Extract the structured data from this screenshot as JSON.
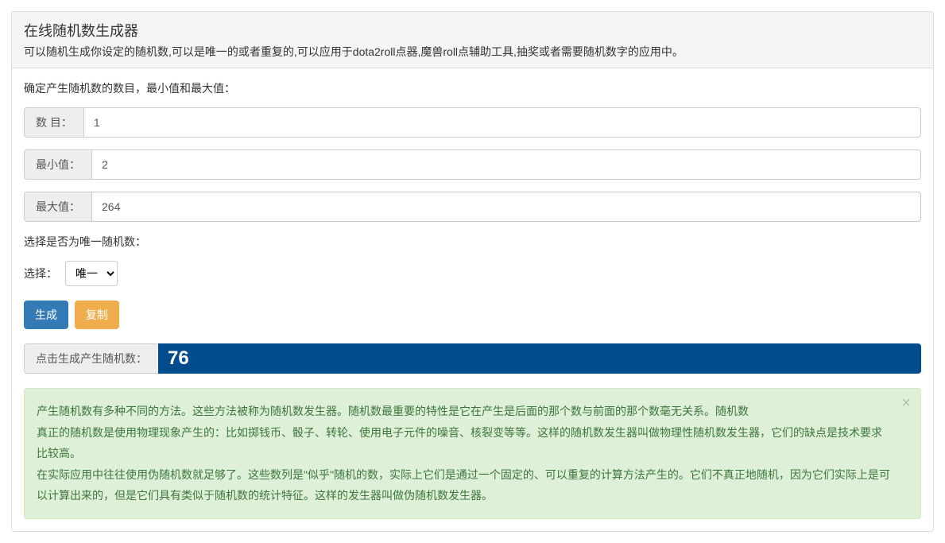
{
  "header": {
    "title": "在线随机数生成器",
    "subtitle": "可以随机生成你设定的随机数,可以是唯一的或者重复的,可以应用于dota2roll点器,魔兽roll点辅助工具,抽奖或者需要随机数字的应用中。"
  },
  "form": {
    "instruction": "确定产生随机数的数目，最小值和最大值：",
    "count": {
      "label": "数 目：",
      "value": "1"
    },
    "min": {
      "label": "最小值：",
      "value": "2"
    },
    "max": {
      "label": "最大值：",
      "value": "264"
    },
    "unique_prompt": "选择是否为唯一随机数：",
    "select_label": "选择：",
    "select_value": "唯一",
    "generate_btn": "生成",
    "copy_btn": "复制"
  },
  "result": {
    "label": "点击生成产生随机数：",
    "value": "76"
  },
  "info": {
    "p1": "产生随机数有多种不同的方法。这些方法被称为随机数发生器。随机数最重要的特性是它在产生是后面的那个数与前面的那个数毫无关系。随机数",
    "p2": "真正的随机数是使用物理现象产生的：比如掷钱币、骰子、转轮、使用电子元件的噪音、核裂变等等。这样的随机数发生器叫做物理性随机数发生器，它们的缺点是技术要求比较高。",
    "p3": "在实际应用中往往使用伪随机数就足够了。这些数列是\"似乎\"随机的数，实际上它们是通过一个固定的、可以重复的计算方法产生的。它们不真正地随机，因为它们实际上是可以计算出来的，但是它们具有类似于随机数的统计特征。这样的发生器叫做伪随机数发生器。"
  }
}
